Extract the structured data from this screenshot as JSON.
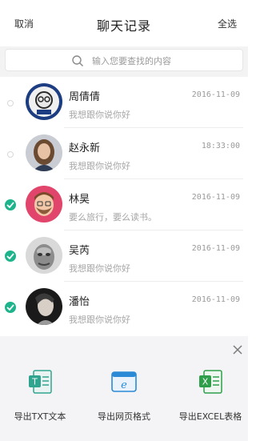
{
  "header": {
    "cancel": "取消",
    "title": "聊天记录",
    "select_all": "全选"
  },
  "search": {
    "placeholder": "输入您要查找的内容"
  },
  "chats": [
    {
      "name": "周倩倩",
      "message": "我想跟你说你好",
      "time": "2016-11-09",
      "selected": false
    },
    {
      "name": "赵永新",
      "message": "我想跟你说你好",
      "time": "18:33:00",
      "selected": false
    },
    {
      "name": "林昊",
      "message": "要么旅行，要么读书。",
      "time": "2016-11-09",
      "selected": true
    },
    {
      "name": "吴芮",
      "message": "我想跟你说你好",
      "time": "2016-11-09",
      "selected": true
    },
    {
      "name": "潘怡",
      "message": "我想跟你说你好",
      "time": "2016-11-09",
      "selected": true
    }
  ],
  "export": {
    "txt": "导出TXT文本",
    "web": "导出网页格式",
    "excel": "导出EXCEL表格",
    "txt_icon_text": "T",
    "web_icon_text": "e",
    "excel_icon_text": "X"
  },
  "colors": {
    "accent": "#1db38b",
    "excel": "#2e9e4a",
    "web": "#2a8ad6"
  }
}
